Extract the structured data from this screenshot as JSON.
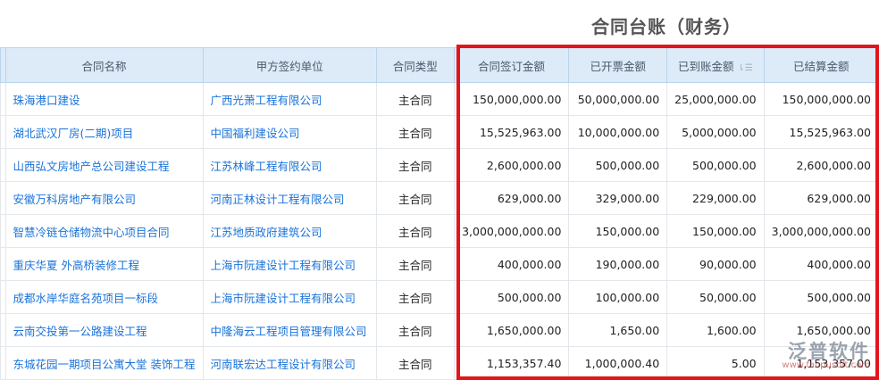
{
  "title": "合同台账（财务）",
  "columns": [
    "合同名称",
    "甲方签约单位",
    "合同类型",
    "合同签订金额",
    "已开票金额",
    "已到账金额",
    "已结算金额"
  ],
  "rows": [
    [
      "珠海港口建设",
      "广西光萧工程有限公司",
      "主合同",
      "150,000,000.00",
      "50,000,000.00",
      "25,000,000.00",
      "150,000,000.00"
    ],
    [
      "湖北武汉厂房(二期)项目",
      "中国福利建设公司",
      "主合同",
      "15,525,963.00",
      "10,000,000.00",
      "5,000,000.00",
      "15,525,963.00"
    ],
    [
      "山西弘文房地产总公司建设工程",
      "江苏林峰工程有限公司",
      "主合同",
      "2,600,000.00",
      "500,000.00",
      "500,000.00",
      "2,600,000.00"
    ],
    [
      "安徽万科房地产有限公司",
      "河南正林设计工程有限公司",
      "主合同",
      "629,000.00",
      "329,000.00",
      "229,000.00",
      "629,000.00"
    ],
    [
      "智慧冷链仓储物流中心项目合同",
      "江苏地质政府建筑公司",
      "主合同",
      "3,000,000,000.00",
      "150,000.00",
      "150,000.00",
      "3,000,000,000.00"
    ],
    [
      "重庆华夏 外高桥装修工程",
      "上海市阮建设计工程有限公司",
      "主合同",
      "400,000.00",
      "190,000.00",
      "90,000.00",
      "400,000.00"
    ],
    [
      "成都水岸华庭名苑项目一标段",
      "上海市阮建设计工程有限公司",
      "主合同",
      "500,000.00",
      "100,000.00",
      "50,000.00",
      "500,000.00"
    ],
    [
      "云南交投第一公路建设工程",
      "中隆海云工程项目管理有限公司",
      "主合同",
      "1,650,000.00",
      "1,650.00",
      "1,600.00",
      "1,650,000.00"
    ],
    [
      "东城花园一期项目公寓大堂 装饰工程",
      "河南联宏达工程设计有限公司",
      "主合同",
      "1,153,357.40",
      "1,000,000.40",
      "5.00",
      "1,153,357.00"
    ]
  ],
  "watermark": {
    "brand": "泛普软件",
    "url": "www.fanpusoft.com"
  },
  "highlight_color": "#e3141c"
}
